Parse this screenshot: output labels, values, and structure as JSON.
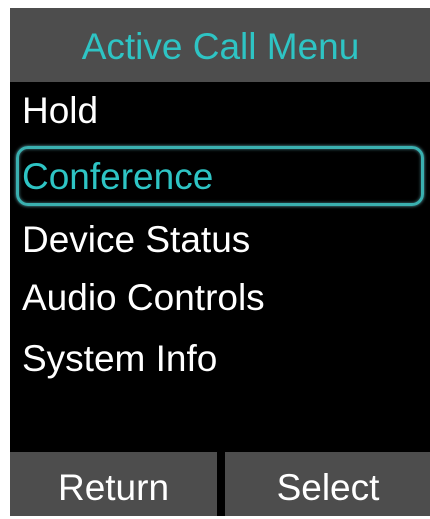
{
  "title": "Active Call Menu",
  "menu": {
    "items": [
      {
        "label": "Hold",
        "selected": false
      },
      {
        "label": "Conference",
        "selected": true
      },
      {
        "label": "Device Status",
        "selected": false
      },
      {
        "label": "Audio Controls",
        "selected": false
      },
      {
        "label": "System Info",
        "selected": false
      }
    ]
  },
  "softkeys": {
    "left": "Return",
    "right": "Select"
  },
  "colors": {
    "accent": "#2ec4c4",
    "bar": "#4d4d4d",
    "background": "#000000",
    "text": "#ffffff"
  }
}
